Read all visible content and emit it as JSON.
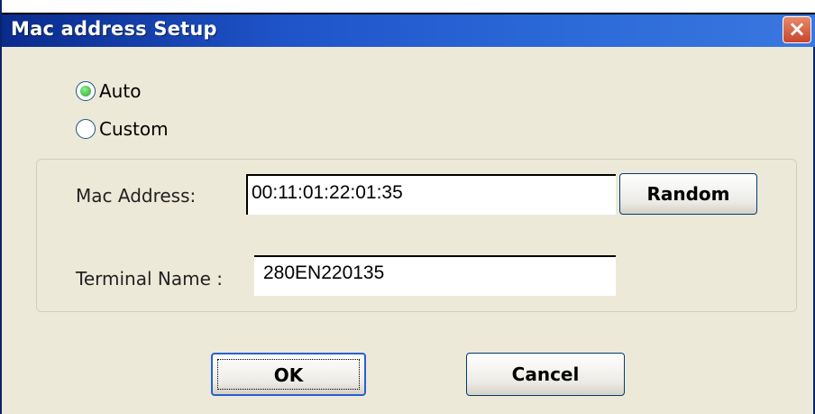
{
  "window": {
    "title": "Mac address Setup",
    "close_symbol": "×"
  },
  "mode": {
    "options": [
      {
        "label": "Auto",
        "selected": true
      },
      {
        "label": "Custom",
        "selected": false
      }
    ]
  },
  "fields": {
    "mac_label": "Mac Address:",
    "mac_value": "00:11:01:22:01:35",
    "terminal_label": "Terminal Name :",
    "terminal_value": "280EN220135"
  },
  "buttons": {
    "random": "Random",
    "ok": "OK",
    "cancel": "Cancel"
  },
  "icons": {
    "close": "close-icon",
    "radio_checked": "radio-checked-icon",
    "radio_unchecked": "radio-unchecked-icon"
  },
  "colors": {
    "titlebar": "#1f54c9",
    "close_button": "#c8452b",
    "dialog_background": "#ece9d8",
    "radio_selected": "#2aa22a"
  }
}
